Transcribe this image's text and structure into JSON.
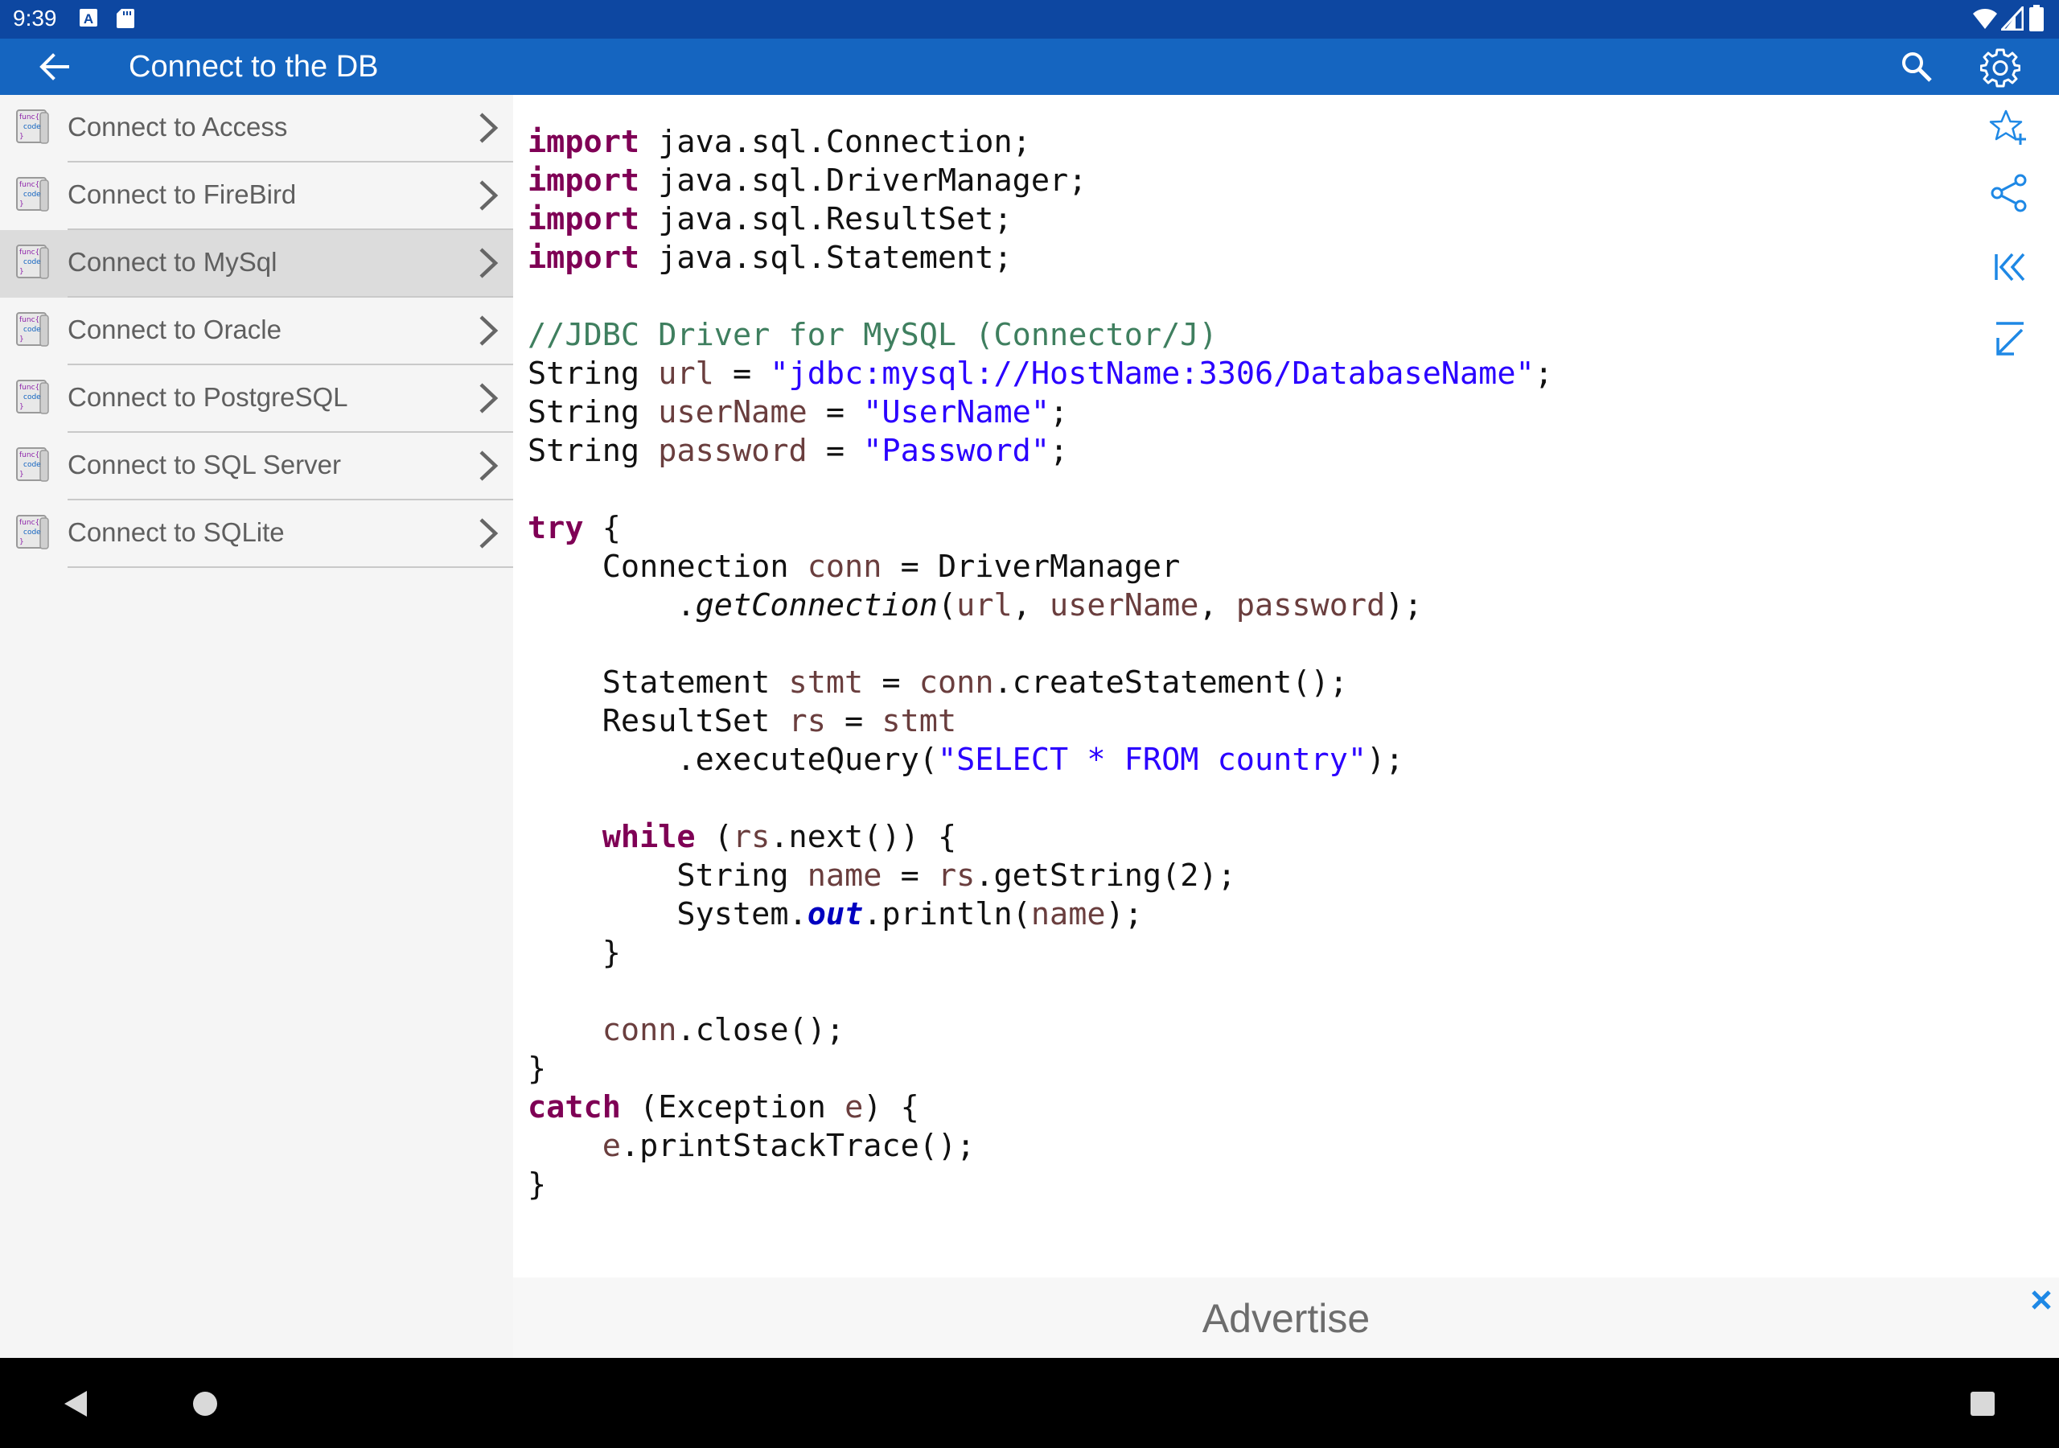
{
  "status_bar": {
    "time": "9:39",
    "icons": [
      "a-notification-icon",
      "sd-card-icon",
      "wifi-icon",
      "cellular-signal-icon",
      "battery-icon"
    ]
  },
  "app_bar": {
    "title": "Connect to the DB",
    "background": "#1565c0",
    "status_background": "#0d47a1",
    "icons": [
      "back-arrow-icon",
      "search-icon",
      "settings-gear-icon"
    ]
  },
  "sidebar": {
    "selected_index": 2,
    "items": [
      {
        "label": "Connect to Access"
      },
      {
        "label": "Connect to FireBird"
      },
      {
        "label": "Connect to MySql"
      },
      {
        "label": "Connect to Oracle"
      },
      {
        "label": "Connect to PostgreSQL"
      },
      {
        "label": "Connect to SQL Server"
      },
      {
        "label": "Connect to SQLite"
      }
    ],
    "item_icon": {
      "line1": "func{",
      "line2": "code",
      "line3": "}"
    }
  },
  "code": {
    "language": "java",
    "imports": [
      {
        "kw": "import",
        "text": " java.sql.Connection;"
      },
      {
        "kw": "import",
        "text": " java.sql.DriverManager;"
      },
      {
        "kw": "import",
        "text": " java.sql.ResultSet;"
      },
      {
        "kw": "import",
        "text": " java.sql.Statement;"
      }
    ],
    "comment": "//JDBC Driver for MySQL (Connector/J)",
    "url_value": "\"jdbc:mysql://HostName:3306/DatabaseName\"",
    "username_value": "\"UserName\"",
    "password_value": "\"Password\"",
    "query_value": "\"SELECT * FROM country\"",
    "colors": {
      "keyword": "#7f0055",
      "string": "#2a00ff",
      "comment": "#3f7f5f",
      "variable": "#6a3e3e",
      "field": "#0000c0"
    }
  },
  "tools": [
    "favorite-add-icon",
    "share-icon",
    "first-page-icon",
    "expand-icon"
  ],
  "ad": {
    "text": "Advertise",
    "close_color": "#1e88e5"
  },
  "navigation": [
    "back-triangle-icon",
    "home-circle-icon",
    "recents-square-icon"
  ]
}
